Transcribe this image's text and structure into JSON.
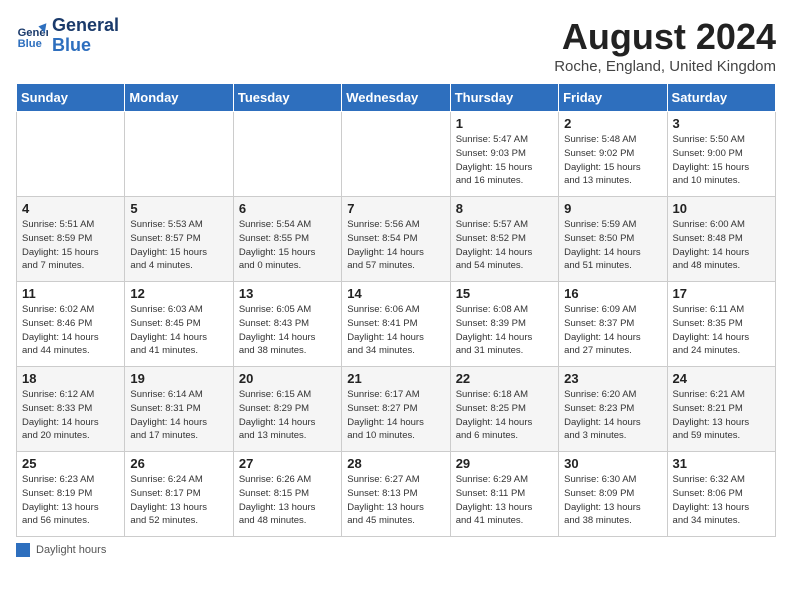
{
  "header": {
    "logo_line1": "General",
    "logo_line2": "Blue",
    "month": "August 2024",
    "location": "Roche, England, United Kingdom"
  },
  "days_of_week": [
    "Sunday",
    "Monday",
    "Tuesday",
    "Wednesday",
    "Thursday",
    "Friday",
    "Saturday"
  ],
  "weeks": [
    [
      {
        "day": "",
        "info": ""
      },
      {
        "day": "",
        "info": ""
      },
      {
        "day": "",
        "info": ""
      },
      {
        "day": "",
        "info": ""
      },
      {
        "day": "1",
        "info": "Sunrise: 5:47 AM\nSunset: 9:03 PM\nDaylight: 15 hours\nand 16 minutes."
      },
      {
        "day": "2",
        "info": "Sunrise: 5:48 AM\nSunset: 9:02 PM\nDaylight: 15 hours\nand 13 minutes."
      },
      {
        "day": "3",
        "info": "Sunrise: 5:50 AM\nSunset: 9:00 PM\nDaylight: 15 hours\nand 10 minutes."
      }
    ],
    [
      {
        "day": "4",
        "info": "Sunrise: 5:51 AM\nSunset: 8:59 PM\nDaylight: 15 hours\nand 7 minutes."
      },
      {
        "day": "5",
        "info": "Sunrise: 5:53 AM\nSunset: 8:57 PM\nDaylight: 15 hours\nand 4 minutes."
      },
      {
        "day": "6",
        "info": "Sunrise: 5:54 AM\nSunset: 8:55 PM\nDaylight: 15 hours\nand 0 minutes."
      },
      {
        "day": "7",
        "info": "Sunrise: 5:56 AM\nSunset: 8:54 PM\nDaylight: 14 hours\nand 57 minutes."
      },
      {
        "day": "8",
        "info": "Sunrise: 5:57 AM\nSunset: 8:52 PM\nDaylight: 14 hours\nand 54 minutes."
      },
      {
        "day": "9",
        "info": "Sunrise: 5:59 AM\nSunset: 8:50 PM\nDaylight: 14 hours\nand 51 minutes."
      },
      {
        "day": "10",
        "info": "Sunrise: 6:00 AM\nSunset: 8:48 PM\nDaylight: 14 hours\nand 48 minutes."
      }
    ],
    [
      {
        "day": "11",
        "info": "Sunrise: 6:02 AM\nSunset: 8:46 PM\nDaylight: 14 hours\nand 44 minutes."
      },
      {
        "day": "12",
        "info": "Sunrise: 6:03 AM\nSunset: 8:45 PM\nDaylight: 14 hours\nand 41 minutes."
      },
      {
        "day": "13",
        "info": "Sunrise: 6:05 AM\nSunset: 8:43 PM\nDaylight: 14 hours\nand 38 minutes."
      },
      {
        "day": "14",
        "info": "Sunrise: 6:06 AM\nSunset: 8:41 PM\nDaylight: 14 hours\nand 34 minutes."
      },
      {
        "day": "15",
        "info": "Sunrise: 6:08 AM\nSunset: 8:39 PM\nDaylight: 14 hours\nand 31 minutes."
      },
      {
        "day": "16",
        "info": "Sunrise: 6:09 AM\nSunset: 8:37 PM\nDaylight: 14 hours\nand 27 minutes."
      },
      {
        "day": "17",
        "info": "Sunrise: 6:11 AM\nSunset: 8:35 PM\nDaylight: 14 hours\nand 24 minutes."
      }
    ],
    [
      {
        "day": "18",
        "info": "Sunrise: 6:12 AM\nSunset: 8:33 PM\nDaylight: 14 hours\nand 20 minutes."
      },
      {
        "day": "19",
        "info": "Sunrise: 6:14 AM\nSunset: 8:31 PM\nDaylight: 14 hours\nand 17 minutes."
      },
      {
        "day": "20",
        "info": "Sunrise: 6:15 AM\nSunset: 8:29 PM\nDaylight: 14 hours\nand 13 minutes."
      },
      {
        "day": "21",
        "info": "Sunrise: 6:17 AM\nSunset: 8:27 PM\nDaylight: 14 hours\nand 10 minutes."
      },
      {
        "day": "22",
        "info": "Sunrise: 6:18 AM\nSunset: 8:25 PM\nDaylight: 14 hours\nand 6 minutes."
      },
      {
        "day": "23",
        "info": "Sunrise: 6:20 AM\nSunset: 8:23 PM\nDaylight: 14 hours\nand 3 minutes."
      },
      {
        "day": "24",
        "info": "Sunrise: 6:21 AM\nSunset: 8:21 PM\nDaylight: 13 hours\nand 59 minutes."
      }
    ],
    [
      {
        "day": "25",
        "info": "Sunrise: 6:23 AM\nSunset: 8:19 PM\nDaylight: 13 hours\nand 56 minutes."
      },
      {
        "day": "26",
        "info": "Sunrise: 6:24 AM\nSunset: 8:17 PM\nDaylight: 13 hours\nand 52 minutes."
      },
      {
        "day": "27",
        "info": "Sunrise: 6:26 AM\nSunset: 8:15 PM\nDaylight: 13 hours\nand 48 minutes."
      },
      {
        "day": "28",
        "info": "Sunrise: 6:27 AM\nSunset: 8:13 PM\nDaylight: 13 hours\nand 45 minutes."
      },
      {
        "day": "29",
        "info": "Sunrise: 6:29 AM\nSunset: 8:11 PM\nDaylight: 13 hours\nand 41 minutes."
      },
      {
        "day": "30",
        "info": "Sunrise: 6:30 AM\nSunset: 8:09 PM\nDaylight: 13 hours\nand 38 minutes."
      },
      {
        "day": "31",
        "info": "Sunrise: 6:32 AM\nSunset: 8:06 PM\nDaylight: 13 hours\nand 34 minutes."
      }
    ]
  ],
  "footer": {
    "daylight_label": "Daylight hours"
  }
}
